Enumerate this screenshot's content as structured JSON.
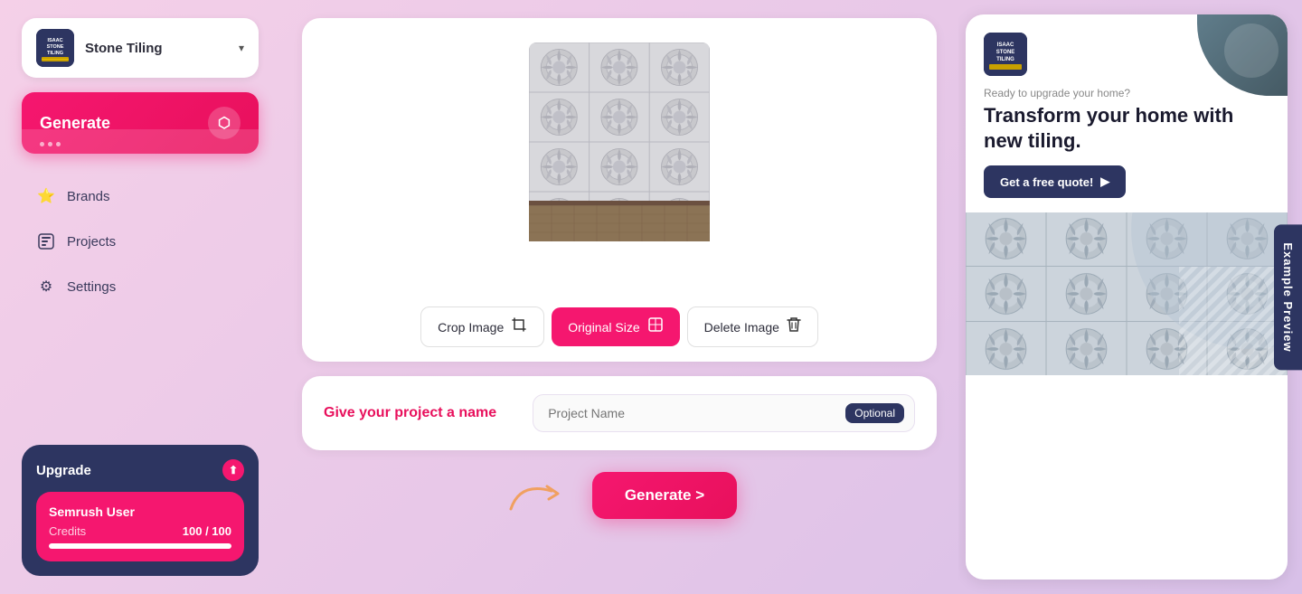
{
  "brand": {
    "name": "Stone Tiling",
    "logo_text": "ISAAC\nSTONE\nTILING"
  },
  "sidebar": {
    "generate_label": "Generate",
    "nav_items": [
      {
        "id": "brands",
        "label": "Brands",
        "icon": "⭐"
      },
      {
        "id": "projects",
        "label": "Projects",
        "icon": "🗂"
      },
      {
        "id": "settings",
        "label": "Settings",
        "icon": "⚙"
      }
    ],
    "upgrade": {
      "label": "Upgrade",
      "user_name": "Semrush User",
      "credits_label": "Credits",
      "credits_used": "100",
      "credits_total": "100",
      "credits_pct": 100
    }
  },
  "image_section": {
    "crop_label": "Crop Image",
    "original_size_label": "Original Size",
    "delete_label": "Delete Image"
  },
  "project_section": {
    "label": "Give your project a name",
    "placeholder": "Project Name",
    "optional_label": "Optional"
  },
  "generate_bottom": {
    "label": "Generate >"
  },
  "preview": {
    "tab_label": "Example Preview",
    "sub_label": "Ready to upgrade your home?",
    "headline": "Transform your home with new tiling.",
    "cta_label": "Get a free quote!",
    "logo_text": "ISAAC\nSTONE\nTILING"
  },
  "colors": {
    "primary": "#f5176f",
    "dark_blue": "#2d3561",
    "bg_gradient_start": "#f5d0e8",
    "bg_gradient_end": "#d8c0e8"
  }
}
